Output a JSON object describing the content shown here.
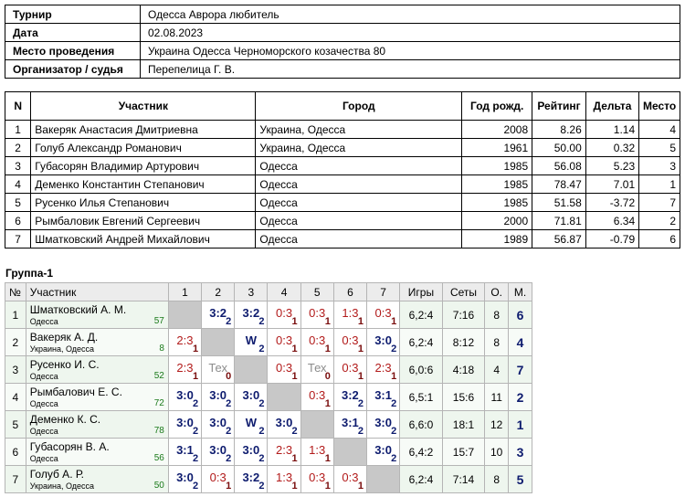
{
  "info": [
    {
      "label": "Турнир",
      "value": "Одесса Аврора  любитель"
    },
    {
      "label": "Дата",
      "value": "02.08.2023"
    },
    {
      "label": "Место проведения",
      "value": "Украина  Одесса  Черноморского  козачества 80"
    },
    {
      "label": "Организатор / судья",
      "value": "Перепелица Г. В."
    }
  ],
  "participants": {
    "headers": [
      "N",
      "Участник",
      "Город",
      "Год рожд.",
      "Рейтинг",
      "Дельта",
      "Место"
    ],
    "rows": [
      [
        "1",
        "Вакеряк Анастасия Дмитриевна",
        "Украина, Одесса",
        "2008",
        "8.26",
        "1.14",
        "4"
      ],
      [
        "2",
        "Голуб Александр  Романович",
        "Украина, Одесса",
        "1961",
        "50.00",
        "0.32",
        "5"
      ],
      [
        "3",
        "Губасорян Владимир Артурович",
        "Одесса",
        "1985",
        "56.08",
        "5.23",
        "3"
      ],
      [
        "4",
        "Деменко Константин Степанович",
        "Одесса",
        "1985",
        "78.47",
        "7.01",
        "1"
      ],
      [
        "5",
        "Русенко Илья Степанович",
        "Одесса",
        "1985",
        "51.58",
        "-3.72",
        "7"
      ],
      [
        "6",
        "Рымбаловик Евгений Сергеевич",
        "Одесса",
        "2000",
        "71.81",
        "6.34",
        "2"
      ],
      [
        "7",
        "Шматковский Андрей Михайлович",
        "Одесса",
        "1989",
        "56.87",
        "-0.79",
        "6"
      ]
    ]
  },
  "group": {
    "title": "Группа-1",
    "headers": [
      "№",
      "Участник",
      "1",
      "2",
      "3",
      "4",
      "5",
      "6",
      "7",
      "Игры",
      "Сеты",
      "О.",
      "М."
    ],
    "rows": [
      {
        "n": "1",
        "name": "Шматковский А. М.",
        "city": "Одесса",
        "rating": "57",
        "cells": [
          null,
          {
            "s": "3:2",
            "p": "2",
            "t": "win"
          },
          {
            "s": "3:2",
            "p": "2",
            "t": "win"
          },
          {
            "s": "0:3",
            "p": "1",
            "t": "loss"
          },
          {
            "s": "0:3",
            "p": "1",
            "t": "loss"
          },
          {
            "s": "1:3",
            "p": "1",
            "t": "loss"
          },
          {
            "s": "0:3",
            "p": "1",
            "t": "loss"
          }
        ],
        "games": "6,2:4",
        "sets": "7:16",
        "points": "8",
        "place": "6"
      },
      {
        "n": "2",
        "name": "Вакеряк А. Д.",
        "city": "Украина, Одесса",
        "rating": "8",
        "cells": [
          {
            "s": "2:3",
            "p": "1",
            "t": "loss"
          },
          null,
          {
            "s": "W",
            "p": "2",
            "t": "texw"
          },
          {
            "s": "0:3",
            "p": "1",
            "t": "loss"
          },
          {
            "s": "0:3",
            "p": "1",
            "t": "loss"
          },
          {
            "s": "0:3",
            "p": "1",
            "t": "loss"
          },
          {
            "s": "3:0",
            "p": "2",
            "t": "win"
          }
        ],
        "games": "6,2:4",
        "sets": "8:12",
        "points": "8",
        "place": "4"
      },
      {
        "n": "3",
        "name": "Русенко И. С.",
        "city": "Одесса",
        "rating": "52",
        "cells": [
          {
            "s": "2:3",
            "p": "1",
            "t": "loss"
          },
          {
            "s": "Тех",
            "p": "0",
            "t": "tex"
          },
          null,
          {
            "s": "0:3",
            "p": "1",
            "t": "loss"
          },
          {
            "s": "Тех",
            "p": "0",
            "t": "tex"
          },
          {
            "s": "0:3",
            "p": "1",
            "t": "loss"
          },
          {
            "s": "2:3",
            "p": "1",
            "t": "loss"
          }
        ],
        "games": "6,0:6",
        "sets": "4:18",
        "points": "4",
        "place": "7"
      },
      {
        "n": "4",
        "name": "Рымбалович Е. С.",
        "city": "Одесса",
        "rating": "72",
        "cells": [
          {
            "s": "3:0",
            "p": "2",
            "t": "win"
          },
          {
            "s": "3:0",
            "p": "2",
            "t": "win"
          },
          {
            "s": "3:0",
            "p": "2",
            "t": "win"
          },
          null,
          {
            "s": "0:3",
            "p": "1",
            "t": "loss"
          },
          {
            "s": "3:2",
            "p": "2",
            "t": "win"
          },
          {
            "s": "3:1",
            "p": "2",
            "t": "win"
          }
        ],
        "games": "6,5:1",
        "sets": "15:6",
        "points": "11",
        "place": "2"
      },
      {
        "n": "5",
        "name": "Деменко К. С.",
        "city": "Одесса",
        "rating": "78",
        "cells": [
          {
            "s": "3:0",
            "p": "2",
            "t": "win"
          },
          {
            "s": "3:0",
            "p": "2",
            "t": "win"
          },
          {
            "s": "W",
            "p": "2",
            "t": "texw"
          },
          {
            "s": "3:0",
            "p": "2",
            "t": "win"
          },
          null,
          {
            "s": "3:1",
            "p": "2",
            "t": "win"
          },
          {
            "s": "3:0",
            "p": "2",
            "t": "win"
          }
        ],
        "games": "6,6:0",
        "sets": "18:1",
        "points": "12",
        "place": "1"
      },
      {
        "n": "6",
        "name": "Губасорян В. А.",
        "city": "Одесса",
        "rating": "56",
        "cells": [
          {
            "s": "3:1",
            "p": "2",
            "t": "win"
          },
          {
            "s": "3:0",
            "p": "2",
            "t": "win"
          },
          {
            "s": "3:0",
            "p": "2",
            "t": "win"
          },
          {
            "s": "2:3",
            "p": "1",
            "t": "loss"
          },
          {
            "s": "1:3",
            "p": "1",
            "t": "loss"
          },
          null,
          {
            "s": "3:0",
            "p": "2",
            "t": "win"
          }
        ],
        "games": "6,4:2",
        "sets": "15:7",
        "points": "10",
        "place": "3"
      },
      {
        "n": "7",
        "name": "Голуб А. Р.",
        "city": "Украина, Одесса",
        "rating": "50",
        "cells": [
          {
            "s": "3:0",
            "p": "2",
            "t": "win"
          },
          {
            "s": "0:3",
            "p": "1",
            "t": "loss"
          },
          {
            "s": "3:2",
            "p": "2",
            "t": "win"
          },
          {
            "s": "1:3",
            "p": "1",
            "t": "loss"
          },
          {
            "s": "0:3",
            "p": "1",
            "t": "loss"
          },
          {
            "s": "0:3",
            "p": "1",
            "t": "loss"
          },
          null
        ],
        "games": "6,2:4",
        "sets": "7:14",
        "points": "8",
        "place": "5"
      }
    ]
  }
}
